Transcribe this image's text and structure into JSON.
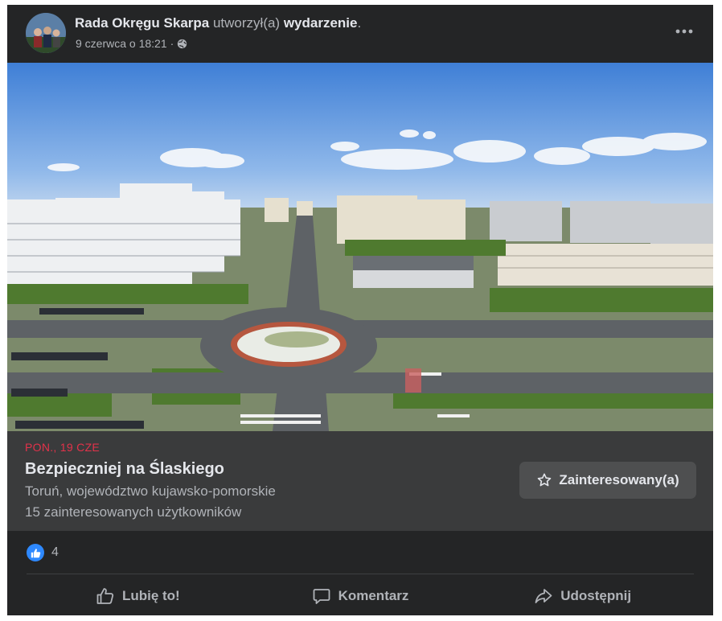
{
  "post": {
    "author": "Rada Okręgu Skarpa",
    "action_text": " utworzył(a) ",
    "action_object": "wydarzenie",
    "action_suffix": ".",
    "timestamp": "9 czerwca o 18:21",
    "separator": "·",
    "privacy_icon": "globe-icon",
    "more_icon": "more-horizontal-icon"
  },
  "event": {
    "date": "PON., 19 CZE",
    "title": "Bezpieczniej na Ślaskiego",
    "location": "Toruń, województwo kujawsko-pomorskie",
    "interested_count": "15 zainteresowanych użytkowników",
    "interested_button_label": "Zainteresowany(a)",
    "interested_button_icon": "star-icon"
  },
  "reactions": {
    "like_icon": "like-icon",
    "count": "4"
  },
  "actions": {
    "like": "Lubię to!",
    "comment": "Komentarz",
    "share": "Udostępnij"
  },
  "colors": {
    "background": "#242526",
    "card": "#3a3b3c",
    "date_red": "#e3324a",
    "like_blue": "#2e89ff",
    "text_primary": "#e4e6eb",
    "text_secondary": "#b0b3b8"
  }
}
